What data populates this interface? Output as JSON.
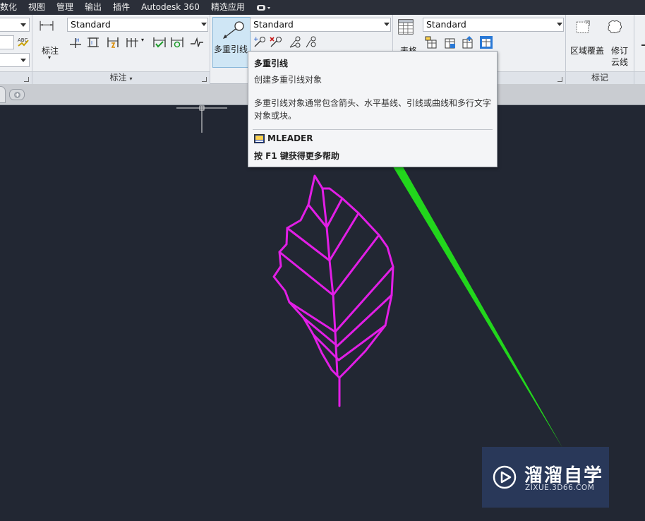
{
  "menu": {
    "items": [
      "数化",
      "视图",
      "管理",
      "输出",
      "插件",
      "Autodesk 360",
      "精选应用"
    ]
  },
  "ribbon": {
    "annotation_panel": {
      "big_button_label": "标注",
      "style_value": "Standard",
      "panel_title": "标注"
    },
    "leader_panel": {
      "big_button_label": "多重引线",
      "style_value": "Standard"
    },
    "table_panel": {
      "big_button_label": "表格",
      "style_value": "Standard"
    },
    "markup_panel": {
      "wipeout_label": "区域覆盖",
      "revcloud_label_line1": "修订",
      "revcloud_label_line2": "云线",
      "panel_title": "标记"
    }
  },
  "tooltip": {
    "title": "多重引线",
    "description": "创建多重引线对象",
    "details": "多重引线对象通常包含箭头、水平基线、引线或曲线和多行文字对象或块。",
    "command": "MLEADER",
    "help": "按 F1 键获得更多帮助"
  },
  "watermark": {
    "brand": "溜溜自学",
    "site": "ZIXUE.3D66.COM"
  },
  "colors": {
    "canvas_bg": "#222733",
    "leaf_stroke": "#e21ee6",
    "arrow": "#22d61c",
    "ribbon_bg": "#eef0f3"
  }
}
